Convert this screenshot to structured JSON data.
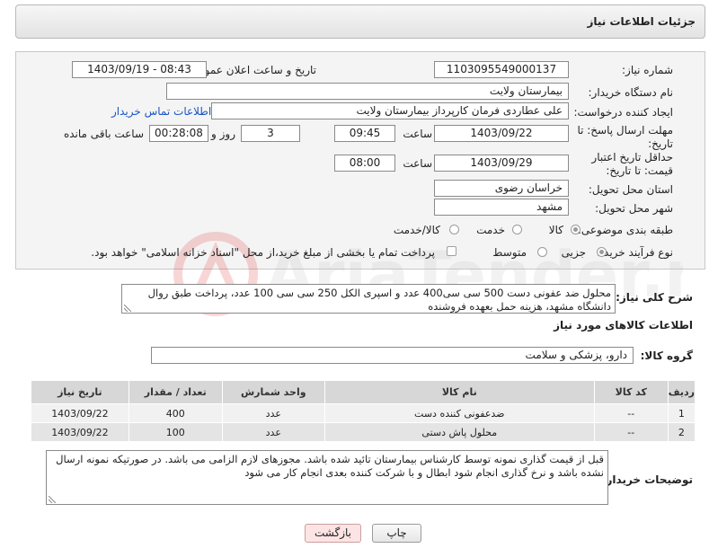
{
  "title": "جزئیات اطلاعات نیاز",
  "need_number": {
    "label": "شماره نیاز:",
    "value": "1103095549000137"
  },
  "announce": {
    "label": "تاریخ و ساعت اعلان عمومی:",
    "value": "1403/09/19 - 08:43"
  },
  "buyer_org": {
    "label": "نام دستگاه خریدار:",
    "value": "بیمارستان ولایت"
  },
  "creator": {
    "label": "ایجاد کننده درخواست:",
    "value": "علی عطاردی فرمان کارپرداز بیمارستان ولایت",
    "contact_link": "اطلاعات تماس خریدار"
  },
  "deadline": {
    "label": "مهلت ارسال پاسخ: تا تاریخ:",
    "date": "1403/09/22",
    "time_label": "ساعت",
    "time": "09:45",
    "days": "3",
    "days_label": "روز و",
    "remaining": "00:28:08",
    "remaining_label": "ساعت باقی مانده"
  },
  "price_validity": {
    "label": "حداقل تاریخ اعتبار قیمت: تا تاریخ:",
    "date": "1403/09/29",
    "time_label": "ساعت",
    "time": "08:00"
  },
  "province": {
    "label": "استان محل تحویل:",
    "value": "خراسان رضوی"
  },
  "city": {
    "label": "شهر محل تحویل:",
    "value": "مشهد"
  },
  "category": {
    "label": "طبقه بندی موضوعی:",
    "options": [
      "کالا",
      "خدمت",
      "کالا/خدمت"
    ],
    "selected": 0
  },
  "purchase_type": {
    "label": "نوع فرآیند خرید :",
    "options": [
      "جزیی",
      "متوسط"
    ],
    "selected": 0,
    "payment_note": "پرداخت تمام یا بخشی از مبلغ خرید،از محل \"اسناد خزانه اسلامی\" خواهد بود."
  },
  "general_desc": {
    "label": "شرح کلی نیاز:",
    "value": "محلول ضد عفونی دست 500 سی سی400 عدد و اسپری الکل 250 سی سی 100 عدد، پرداخت طبق روال دانشگاه مشهد، هزینه حمل بعهده فروشنده"
  },
  "goods_info_title": "اطلاعات کالاهای مورد نیاز",
  "goods_group": {
    "label": "گروه کالا:",
    "value": "دارو، پزشکی و سلامت"
  },
  "table": {
    "headers": [
      "ردیف",
      "کد کالا",
      "نام کالا",
      "واحد شمارش",
      "تعداد / مقدار",
      "تاریخ نیاز"
    ],
    "rows": [
      [
        "1",
        "--",
        "ضدعفونی کننده دست",
        "عدد",
        "400",
        "1403/09/22"
      ],
      [
        "2",
        "--",
        "محلول پاش دستی",
        "عدد",
        "100",
        "1403/09/22"
      ]
    ]
  },
  "buyer_notes": {
    "label": "توضیحات خریدار:",
    "value": "قبل از قیمت گذاری نمونه توسط کارشناس بیمارستان تائید شده باشد. مجوزهای لازم الزامی می باشد. در صورتیکه نمونه ارسال نشده باشد و نرخ گذاری انجام شود ابطال و با شرکت کننده بعدی انجام کار می شود"
  },
  "buttons": {
    "print": "چاپ",
    "back": "بازگشت"
  },
  "colors": {
    "link": "#1a55c4",
    "back_button_bg": "#fde4e4"
  }
}
